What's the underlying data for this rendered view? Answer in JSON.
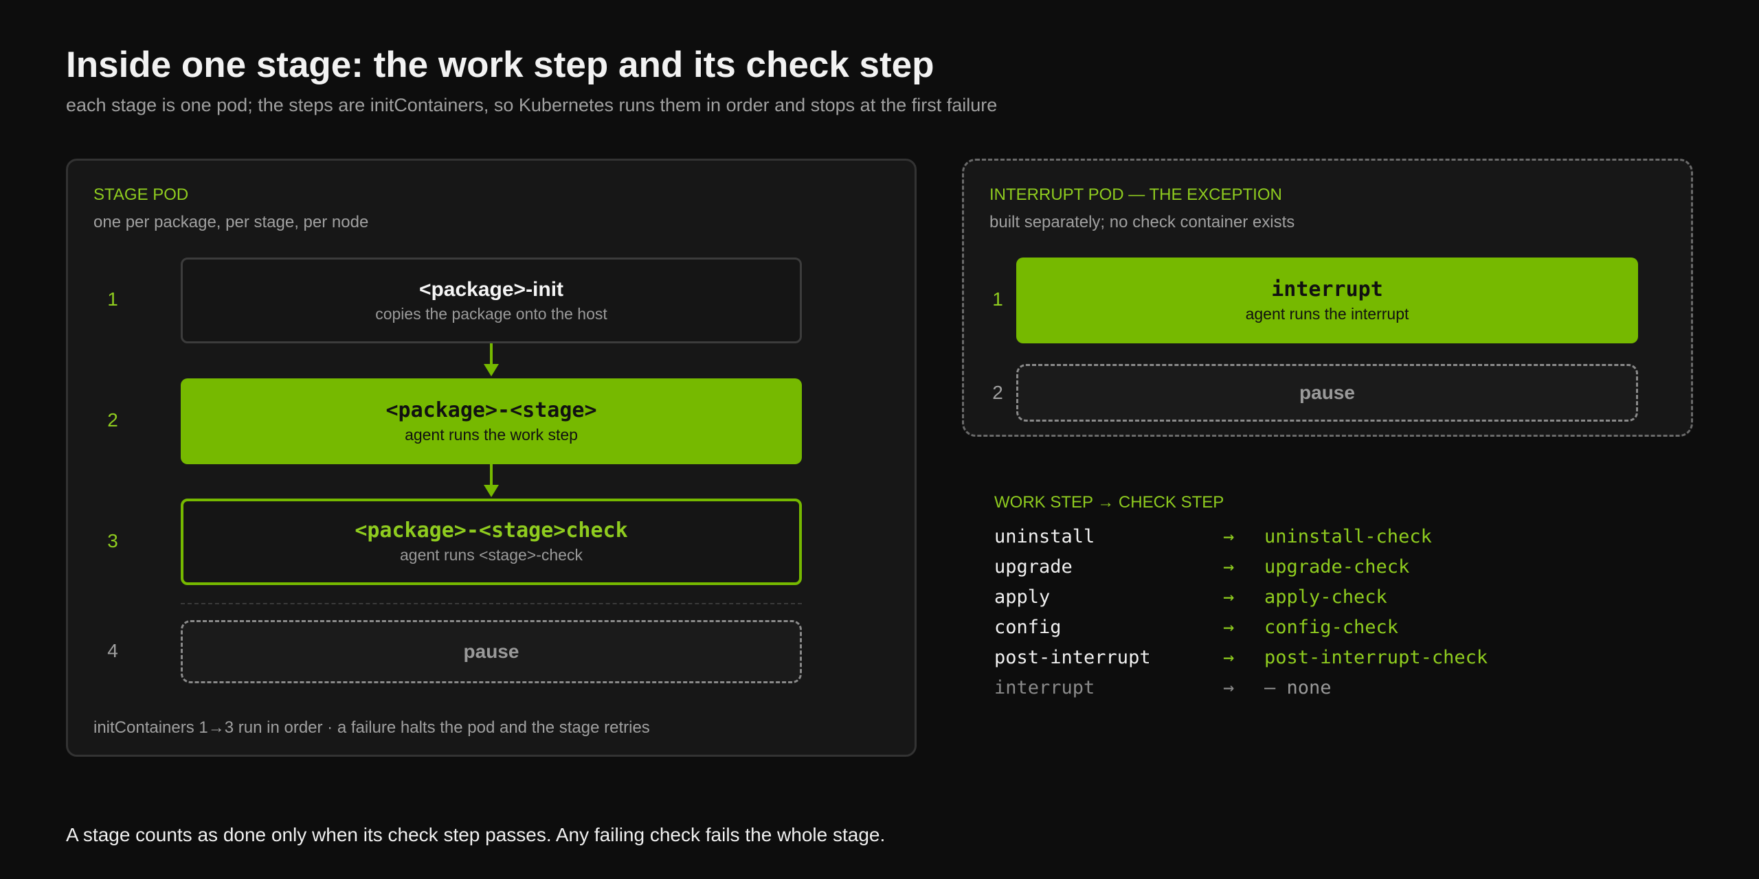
{
  "title": "Inside one stage: the work step and its check step",
  "subtitle": "each stage is one pod; the steps are initContainers, so Kubernetes runs them in order and stops at the first failure",
  "stage_pod": {
    "label": "STAGE POD",
    "desc": "one per package, per stage, per node",
    "steps": [
      {
        "num": "1",
        "title": "<package>-init",
        "sub": "copies the package onto the host"
      },
      {
        "num": "2",
        "title": "<package>-<stage>",
        "sub": "agent runs the work step"
      },
      {
        "num": "3",
        "title": "<package>-<stage>check",
        "sub": "agent runs <stage>-check"
      },
      {
        "num": "4",
        "title": "pause"
      }
    ],
    "note": "initContainers 1→3 run in order · a failure halts the pod and the stage retries"
  },
  "interrupt_pod": {
    "label": "INTERRUPT POD — THE EXCEPTION",
    "desc": "built separately; no check container exists",
    "steps": [
      {
        "num": "1",
        "title": "interrupt",
        "sub": "agent runs the interrupt"
      },
      {
        "num": "2",
        "title": "pause"
      }
    ]
  },
  "mapping": {
    "header": "WORK STEP → CHECK STEP",
    "arrow": "→",
    "rows": [
      {
        "work": "uninstall",
        "check": "uninstall-check"
      },
      {
        "work": "upgrade",
        "check": "upgrade-check"
      },
      {
        "work": "apply",
        "check": "apply-check"
      },
      {
        "work": "config",
        "check": "config-check"
      },
      {
        "work": "post-interrupt",
        "check": "post-interrupt-check"
      },
      {
        "work": "interrupt",
        "check": "— none"
      }
    ]
  },
  "footer": "A stage counts as done only when its check step passes. Any failing check fails the whole stage.",
  "colors": {
    "accent": "#76b900",
    "accent_text": "#8fcc1f",
    "background": "#0d0d0d",
    "panel": "#171717"
  }
}
